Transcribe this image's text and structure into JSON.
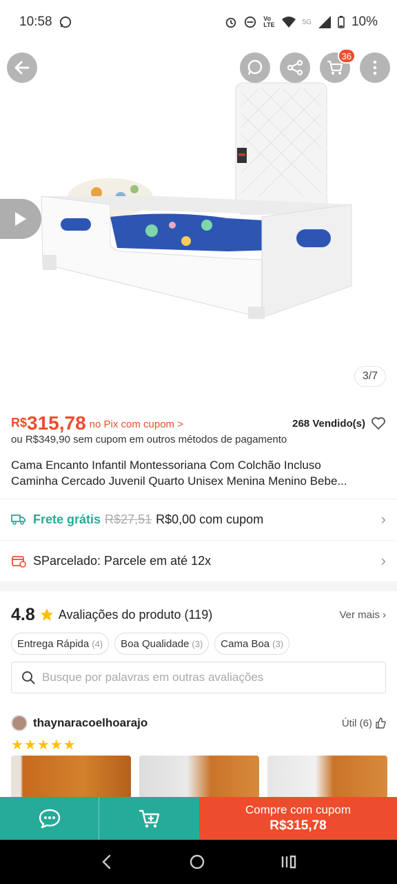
{
  "status_bar": {
    "time": "10:58",
    "network": "5G",
    "battery": "10%"
  },
  "gallery": {
    "counter": "3/7",
    "cart_count": "36"
  },
  "product": {
    "currency": "R$",
    "price": "315,78",
    "pix_note": "no Pix com cupom >",
    "sold": "268 Vendido(s)",
    "alt_price": "ou R$349,90 sem cupom em outros métodos de pagamento",
    "title_line1": "Cama Encanto Infantil Montessoriana Com Colchão Incluso",
    "title_line2": "Caminha Cercado Juvenil Quarto Unisex Menina Menino Bebe..."
  },
  "shipping": {
    "label": "Frete grátis",
    "old_price": "R$27,51",
    "new_price": "R$0,00 com cupom"
  },
  "installments": {
    "label": "SParcelado: Parcele em até 12x"
  },
  "reviews": {
    "rating": "4.8",
    "title": "Avaliações do produto (119)",
    "see_more": "Ver mais",
    "chips": [
      {
        "label": "Entrega Rápida",
        "count": "(4)"
      },
      {
        "label": "Boa Qualidade",
        "count": "(3)"
      },
      {
        "label": "Cama Boa",
        "count": "(3)"
      }
    ],
    "search_placeholder": "Busque por palavras em outras avaliações",
    "first": {
      "name": "thaynaracoelhoarajo",
      "useful": "Útil (6)",
      "stars": "★★★★★"
    }
  },
  "bottom_bar": {
    "buy_line1": "Compre com cupom",
    "buy_line2": "R$315,78"
  },
  "colors": {
    "brand": "#ee4d2d",
    "teal": "#26aa99",
    "star": "#ffbf00"
  }
}
